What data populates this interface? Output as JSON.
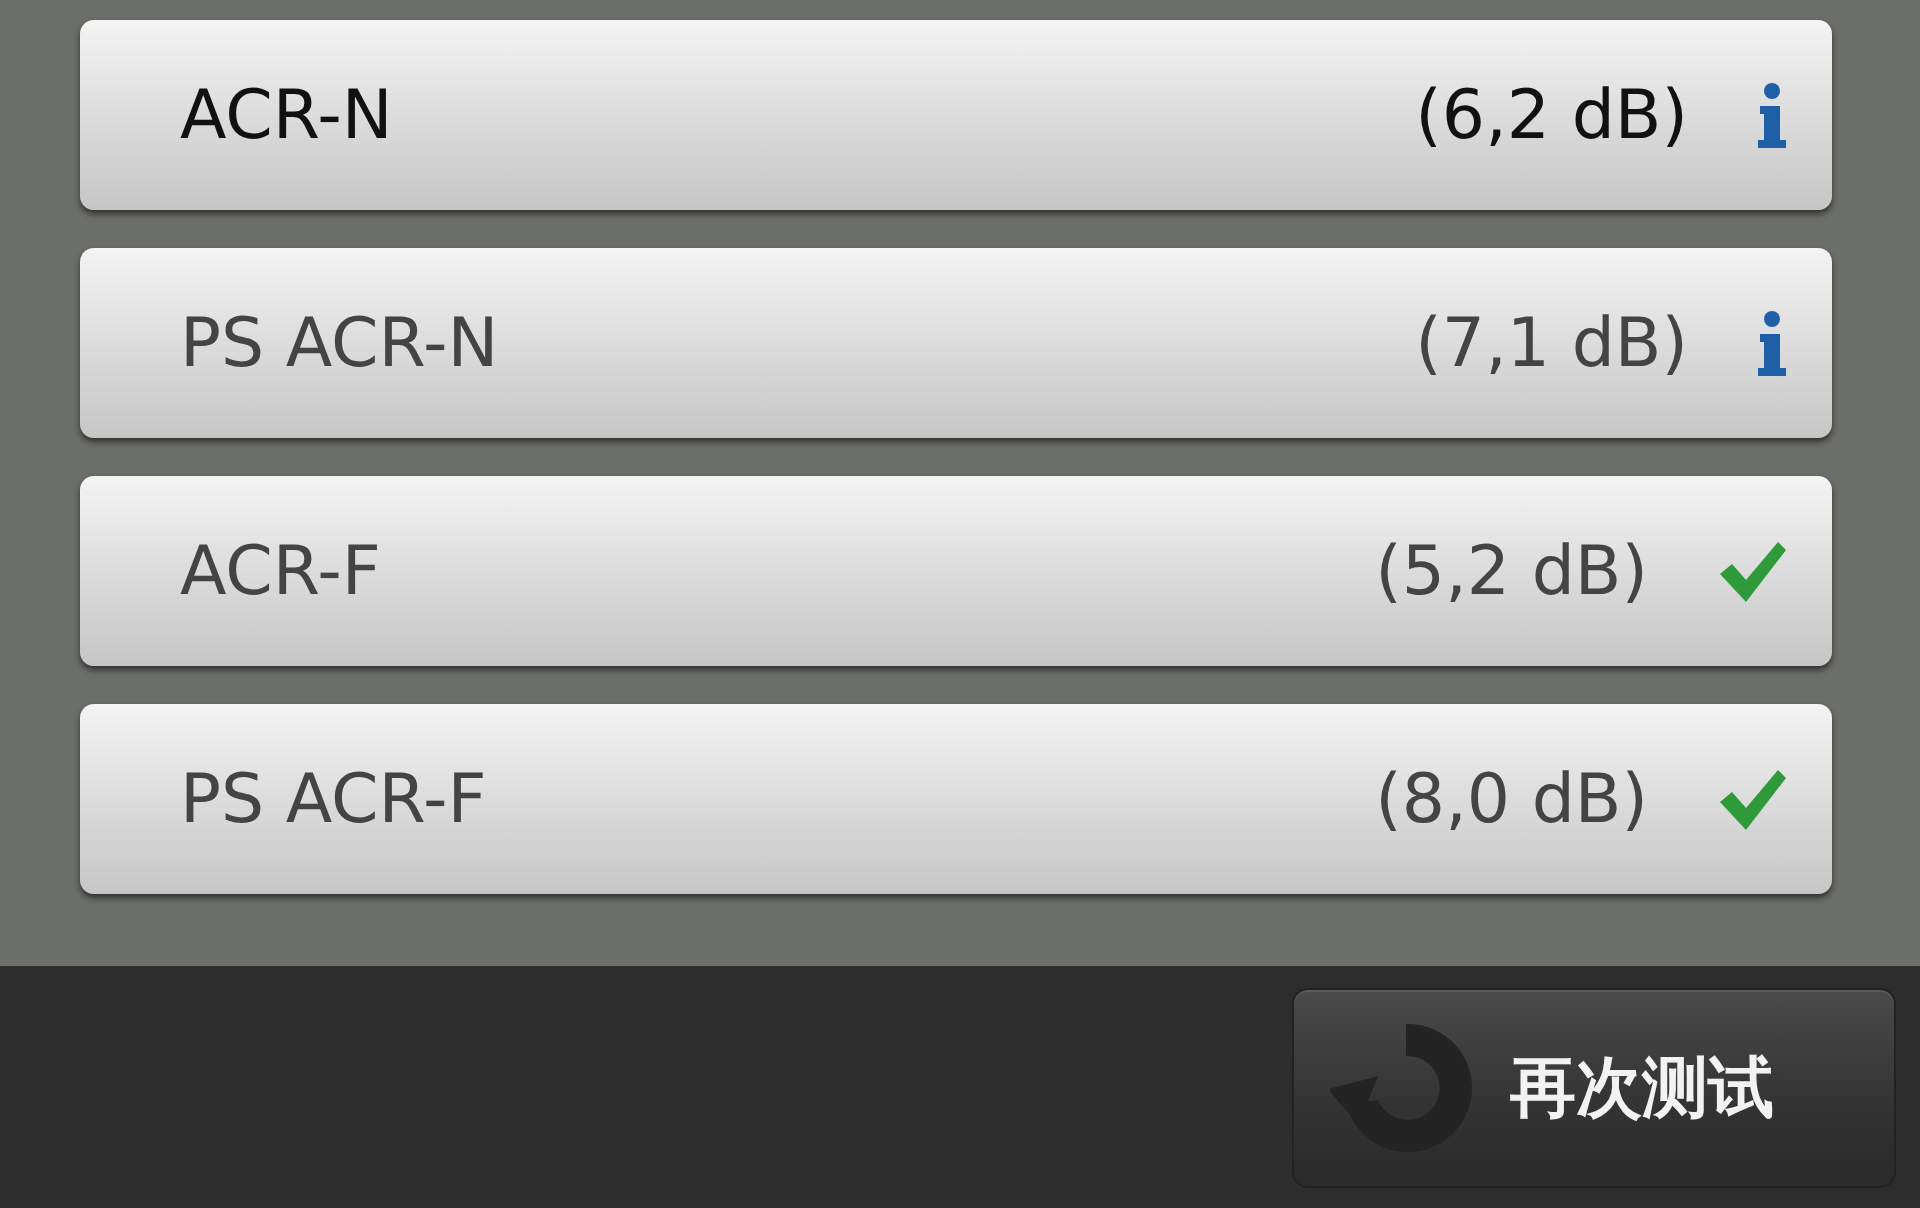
{
  "results": [
    {
      "name": "ACR-N",
      "value": "(6,2 dB)",
      "kind": "info",
      "selected": true
    },
    {
      "name": "PS ACR-N",
      "value": "(7,1 dB)",
      "kind": "info",
      "selected": false
    },
    {
      "name": "ACR-F",
      "value": "(5,2 dB)",
      "kind": "pass",
      "selected": false
    },
    {
      "name": "PS ACR-F",
      "value": "(8,0 dB)",
      "kind": "pass",
      "selected": false
    }
  ],
  "retest_button": {
    "label": "再次测试"
  }
}
